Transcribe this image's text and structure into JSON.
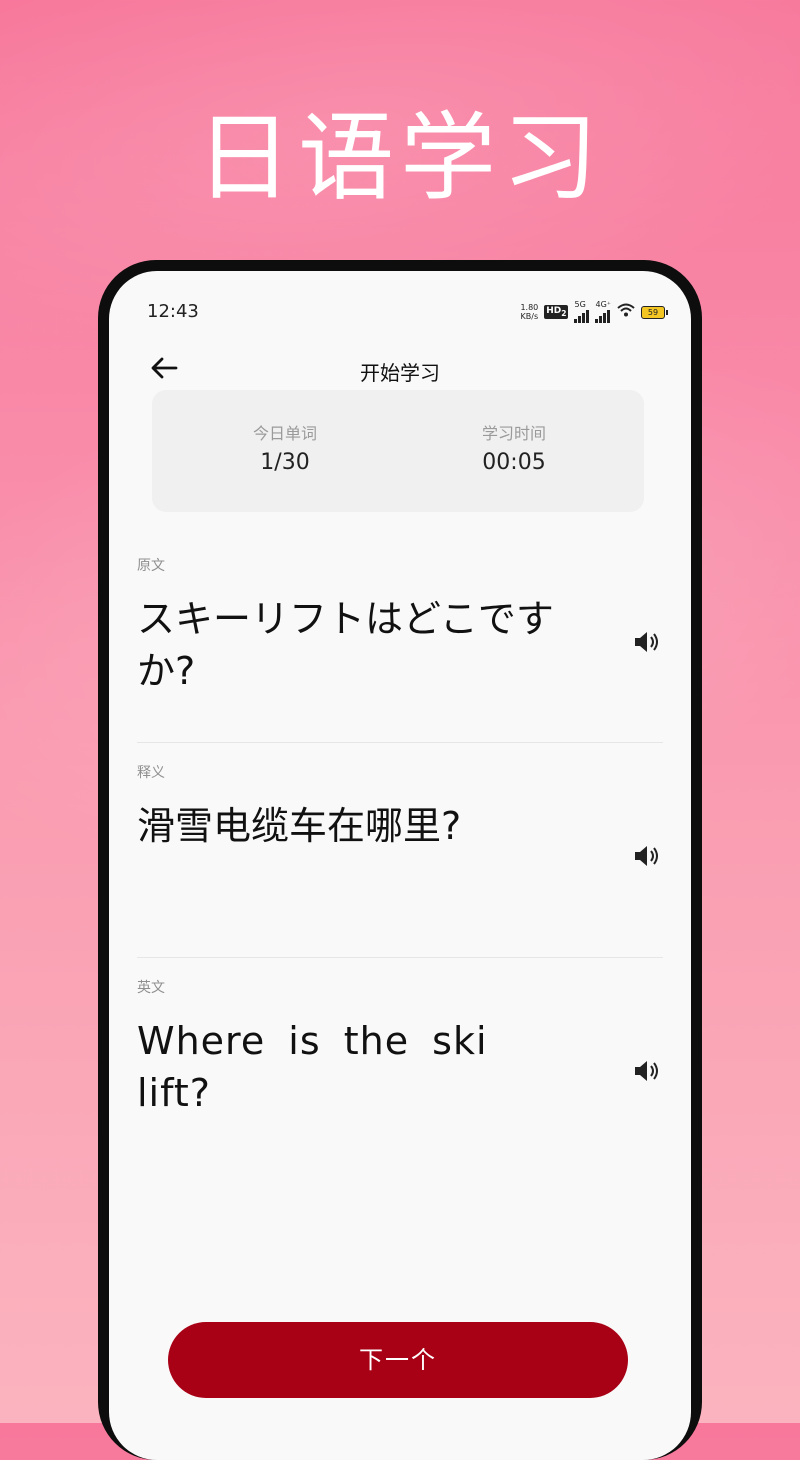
{
  "headline": "日语学习",
  "status_bar": {
    "time": "12:43",
    "net_speed": "1.80",
    "net_unit": "KB/s",
    "hd": "HD",
    "hd_sub": "2",
    "sig1": "5G",
    "sig2": "4G⁺",
    "battery": "59"
  },
  "nav": {
    "title": "开始学习"
  },
  "stats": {
    "today_words_label": "今日单词",
    "today_words_value": "1/30",
    "study_time_label": "学习时间",
    "study_time_value": "00:05"
  },
  "original": {
    "label": "原文",
    "text": "スキーリフトはどこですか?"
  },
  "meaning": {
    "label": "释义",
    "text": "滑雪电缆车在哪里?"
  },
  "english": {
    "label": "英文",
    "text": "Where is the ski lift?"
  },
  "next_button": {
    "label": "下一个"
  },
  "colors": {
    "accent": "#a80015",
    "background_top": "#f7789b",
    "background_bottom": "#fbb4bf"
  },
  "icons": [
    "back-arrow-icon",
    "speaker-icon",
    "wifi-icon",
    "battery-icon",
    "signal-icon"
  ]
}
